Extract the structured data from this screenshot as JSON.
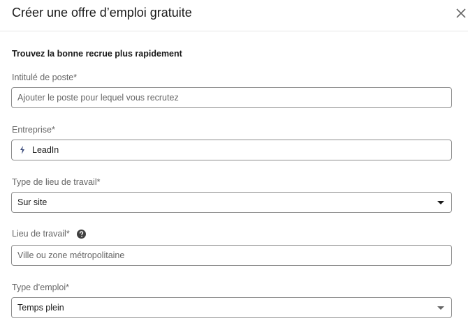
{
  "modal": {
    "title": "Créer une offre d’emploi gratuite",
    "close_icon": "close-icon"
  },
  "form": {
    "subtitle": "Trouvez la bonne recrue plus rapidement",
    "job_title": {
      "label": "Intitulé de poste*",
      "placeholder": "Ajouter le poste pour lequel vous recrutez",
      "value": ""
    },
    "company": {
      "label": "Entreprise*",
      "value": "LeadIn",
      "icon": "company-logo-icon"
    },
    "workplace_type": {
      "label": "Type de lieu de travail*",
      "selected": "Sur site"
    },
    "location": {
      "label": "Lieu de travail*",
      "placeholder": "Ville ou zone métropolitaine",
      "value": "",
      "help_icon": "question-circle-icon"
    },
    "employment_type": {
      "label": "Type d’emploi*",
      "selected": "Temps plein"
    }
  },
  "colors": {
    "text": "#191919",
    "muted": "#666666",
    "border": "#8c8c8c",
    "divider": "#e6e6e6",
    "brand_icon": "#3a4a7a"
  }
}
